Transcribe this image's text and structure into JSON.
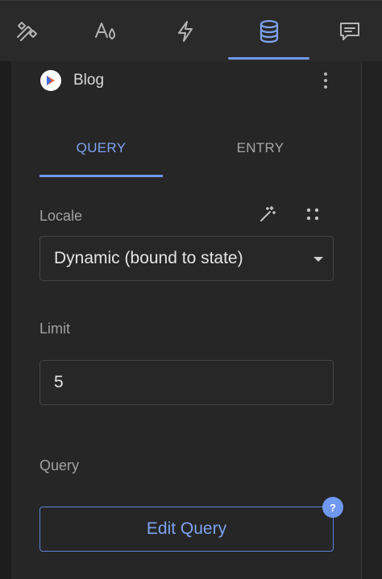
{
  "toolbar": {
    "icons": [
      "design-tools-icon",
      "typography-icon",
      "actions-icon",
      "database-icon",
      "comments-icon"
    ],
    "active_icon": "database-icon"
  },
  "panel": {
    "collection_name": "Blog",
    "tabs": [
      {
        "label": "QUERY",
        "active": true
      },
      {
        "label": "ENTRY",
        "active": false
      }
    ],
    "locale": {
      "label": "Locale",
      "value": "Dynamic (bound to state)"
    },
    "limit": {
      "label": "Limit",
      "value": "5"
    },
    "query": {
      "label": "Query",
      "button_label": "Edit Query",
      "badge": "?"
    }
  },
  "colors": {
    "accent": "#6f98f0",
    "background": "#262626",
    "text": "#e4e4e4"
  }
}
